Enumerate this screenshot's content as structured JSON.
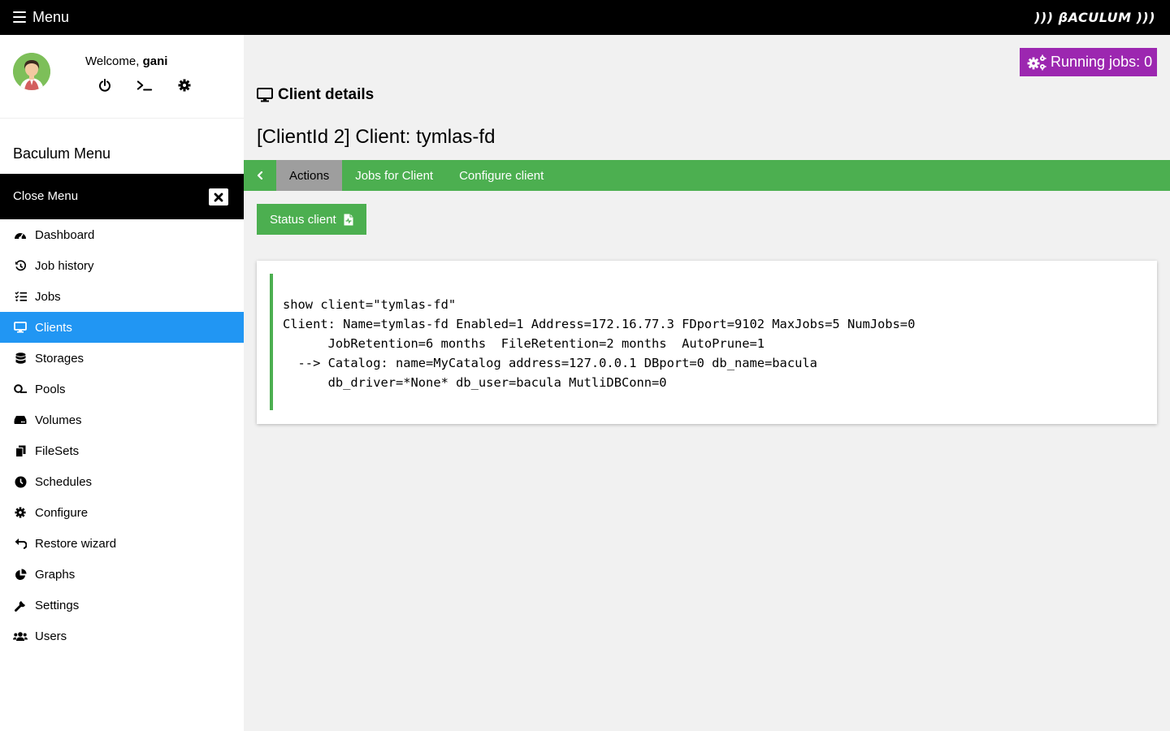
{
  "topbar": {
    "menu_label": "Menu",
    "logo_text": "))) βACULUM )))"
  },
  "user": {
    "welcome_text": "Welcome,",
    "username": "gani",
    "icons": [
      "power-icon",
      "terminal-icon",
      "gear-icon"
    ]
  },
  "sidebar": {
    "title": "Baculum Menu",
    "close_label": "Close Menu",
    "items": [
      {
        "label": "Dashboard",
        "icon": "dashboard-icon"
      },
      {
        "label": "Job history",
        "icon": "history-icon"
      },
      {
        "label": "Jobs",
        "icon": "tasks-icon"
      },
      {
        "label": "Clients",
        "icon": "desktop-icon",
        "active": true
      },
      {
        "label": "Storages",
        "icon": "database-icon"
      },
      {
        "label": "Pools",
        "icon": "pool-icon"
      },
      {
        "label": "Volumes",
        "icon": "hdd-icon"
      },
      {
        "label": "FileSets",
        "icon": "copy-icon"
      },
      {
        "label": "Schedules",
        "icon": "clock-icon"
      },
      {
        "label": "Configure",
        "icon": "cog-icon"
      },
      {
        "label": "Restore wizard",
        "icon": "undo-icon"
      },
      {
        "label": "Graphs",
        "icon": "chart-pie-icon"
      },
      {
        "label": "Settings",
        "icon": "wrench-icon"
      },
      {
        "label": "Users",
        "icon": "users-icon"
      }
    ]
  },
  "main": {
    "running_jobs": "Running jobs: 0",
    "section_title": "Client details",
    "client_title": "[ClientId 2] Client: tymlas-fd",
    "tabs": [
      {
        "label": "Actions",
        "active": true
      },
      {
        "label": "Jobs for Client"
      },
      {
        "label": "Configure client"
      }
    ],
    "status_button": "Status client",
    "output_lines": [
      "show client=\"tymlas-fd\"",
      "Client: Name=tymlas-fd Enabled=1 Address=172.16.77.3 FDport=9102 MaxJobs=5 NumJobs=0",
      "      JobRetention=6 months  FileRetention=2 months  AutoPrune=1",
      "  --> Catalog: name=MyCatalog address=127.0.0.1 DBport=0 db_name=bacula",
      "      db_driver=*None* db_user=bacula MutliDBConn=0"
    ]
  },
  "colors": {
    "topbar": "#000000",
    "accent_green": "#4caf50",
    "active_blue": "#2196f3",
    "running_purple": "#9c27b0",
    "tab_active": "#9e9e9e"
  }
}
